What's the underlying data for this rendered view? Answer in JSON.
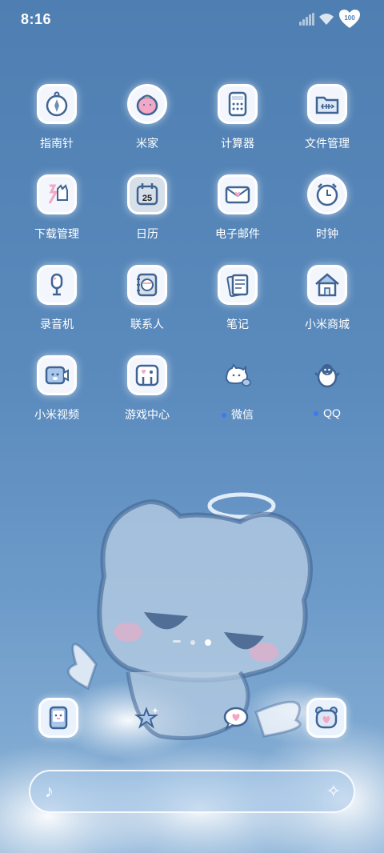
{
  "status_bar": {
    "time": "8:16",
    "battery_level": "100"
  },
  "apps": [
    {
      "label": "指南针",
      "icon": "compass-icon",
      "dot": false
    },
    {
      "label": "米家",
      "icon": "strawberry-icon",
      "dot": false
    },
    {
      "label": "计算器",
      "icon": "calculator-icon",
      "dot": false
    },
    {
      "label": "文件管理",
      "icon": "folder-fish-icon",
      "dot": false
    },
    {
      "label": "下载管理",
      "icon": "download-cat-icon",
      "dot": false
    },
    {
      "label": "日历",
      "icon": "calendar-icon",
      "dot": false,
      "date": "25"
    },
    {
      "label": "电子邮件",
      "icon": "envelope-heart-icon",
      "dot": false
    },
    {
      "label": "时钟",
      "icon": "alarm-clock-icon",
      "dot": false
    },
    {
      "label": "录音机",
      "icon": "microphone-icon",
      "dot": false
    },
    {
      "label": "联系人",
      "icon": "contacts-book-icon",
      "dot": false
    },
    {
      "label": "笔记",
      "icon": "notes-icon",
      "dot": false
    },
    {
      "label": "小米商城",
      "icon": "house-icon",
      "dot": false
    },
    {
      "label": "小米视频",
      "icon": "video-cat-icon",
      "dot": false
    },
    {
      "label": "游戏中心",
      "icon": "game-heart-icon",
      "dot": false
    },
    {
      "label": "微信",
      "icon": "wechat-cat-icon",
      "dot": true
    },
    {
      "label": "QQ",
      "icon": "penguin-icon",
      "dot": true
    }
  ],
  "dock": [
    {
      "icon": "phone-cat-icon"
    },
    {
      "icon": "star-sparkle-icon"
    },
    {
      "icon": "chat-heart-icon"
    },
    {
      "icon": "bear-heart-icon"
    }
  ],
  "pager": {
    "pages": 3,
    "current": 3
  },
  "search_bar": {
    "left_icon": "music-note-icon",
    "right_icon": "sparkle-icon"
  },
  "colors": {
    "background": "#5b8bbd",
    "icon_fill": "#f3f7fd",
    "accent_pink": "#f2a8c4",
    "notification_dot": "#3b7bf0"
  }
}
